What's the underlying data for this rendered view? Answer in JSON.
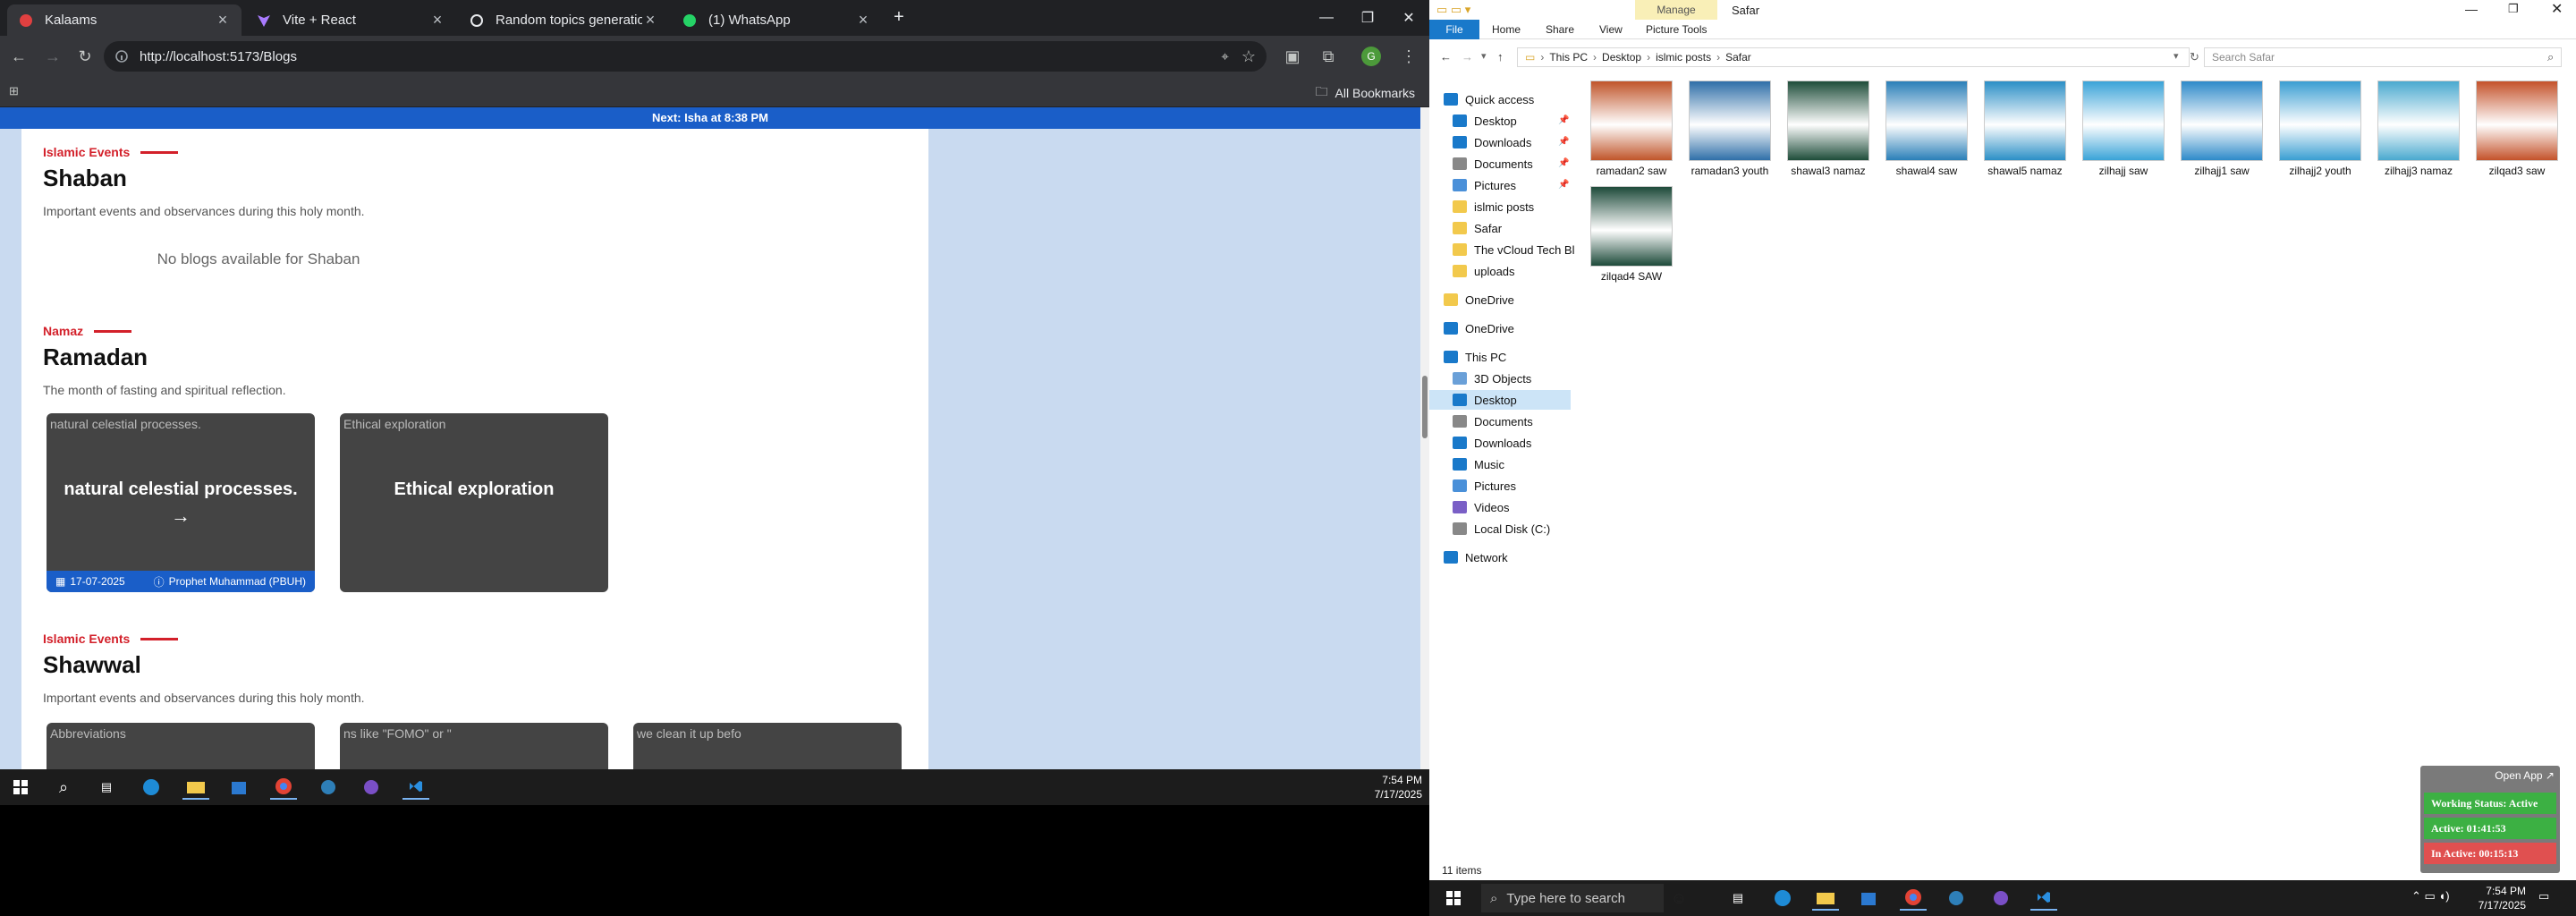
{
  "chrome": {
    "tabs": [
      {
        "label": "Kalaams",
        "active": true,
        "icon": "app-favicon"
      },
      {
        "label": "Vite + React",
        "active": false,
        "icon": "vite-favicon"
      },
      {
        "label": "Random topics generation",
        "active": false,
        "icon": "openai-favicon"
      },
      {
        "label": "(1) WhatsApp",
        "active": false,
        "icon": "whatsapp-favicon"
      }
    ],
    "url": "http://localhost:5173/Blogs",
    "all_bookmarks": "All Bookmarks"
  },
  "page": {
    "next_bar": "Next: Isha at 8:38 PM",
    "sections": [
      {
        "tag": "Islamic Events",
        "title": "Shaban",
        "desc": "Important events and observances during this holy month.",
        "empty": "No blogs available for Shaban"
      },
      {
        "tag": "Namaz",
        "title": "Ramadan",
        "desc": "The month of fasting and spiritual reflection.",
        "cards": [
          {
            "alt": "natural celestial processes.",
            "title": "natural celestial processes.",
            "arrow": "→",
            "date": "17-07-2025",
            "author": "Prophet Muhammad (PBUH)"
          },
          {
            "alt": "Ethical exploration",
            "title": "Ethical exploration"
          }
        ]
      },
      {
        "tag": "Islamic Events",
        "title": "Shawwal",
        "desc": "Important events and observances during this holy month.",
        "cards": [
          {
            "alt": "Abbreviations"
          },
          {
            "alt": "ns like \"FOMO\" or \""
          },
          {
            "alt": "we clean it up befo"
          }
        ]
      }
    ]
  },
  "left_taskbar": {
    "time": "7:54 PM",
    "date": "7/17/2025"
  },
  "explorer": {
    "title": "Safar",
    "manage_label": "Manage",
    "ribbon_tabs": [
      "File",
      "Home",
      "Share",
      "View",
      "Picture Tools"
    ],
    "breadcrumb": [
      "This PC",
      "Desktop",
      "islmic posts",
      "Safar"
    ],
    "search_placeholder": "Search Safar",
    "nav": [
      {
        "label": "Quick access",
        "icon": "star-icon"
      },
      {
        "label": "Desktop",
        "icon": "desktop-icon",
        "pinned": true
      },
      {
        "label": "Downloads",
        "icon": "download-icon",
        "pinned": true
      },
      {
        "label": "Documents",
        "icon": "documents-icon",
        "pinned": true
      },
      {
        "label": "Pictures",
        "icon": "pictures-icon",
        "pinned": true
      },
      {
        "label": "islmic posts",
        "icon": "folder-icon"
      },
      {
        "label": "Safar",
        "icon": "folder-icon"
      },
      {
        "label": "The vCloud Tech Bl",
        "icon": "folder-icon"
      },
      {
        "label": "uploads",
        "icon": "folder-icon"
      },
      {
        "label": "OneDrive",
        "icon": "folder-icon"
      },
      {
        "label": "OneDrive",
        "icon": "cloud-icon"
      },
      {
        "label": "This PC",
        "icon": "pc-icon"
      },
      {
        "label": "3D Objects",
        "icon": "cube-icon"
      },
      {
        "label": "Desktop",
        "icon": "desktop-icon",
        "selected": true
      },
      {
        "label": "Documents",
        "icon": "documents-icon"
      },
      {
        "label": "Downloads",
        "icon": "download-icon"
      },
      {
        "label": "Music",
        "icon": "music-icon"
      },
      {
        "label": "Pictures",
        "icon": "pictures-icon"
      },
      {
        "label": "Videos",
        "icon": "videos-icon"
      },
      {
        "label": "Local Disk (C:)",
        "icon": "disk-icon"
      },
      {
        "label": "Network",
        "icon": "network-icon"
      }
    ],
    "files": [
      {
        "name": "ramadan2 saw",
        "color": "#c0552a"
      },
      {
        "name": "ramadan3 youth",
        "color": "#2f6fa8"
      },
      {
        "name": "shawal3 namaz",
        "color": "#1e4d3a"
      },
      {
        "name": "shawal4 saw",
        "color": "#2a7fb8"
      },
      {
        "name": "shawal5 namaz",
        "color": "#2b8fc6"
      },
      {
        "name": "zilhajj saw",
        "color": "#3aa3d8"
      },
      {
        "name": "zilhajj1 saw",
        "color": "#2e8ac9"
      },
      {
        "name": "zilhajj2 youth",
        "color": "#3a9ed2"
      },
      {
        "name": "zilhajj3 namaz",
        "color": "#4aa9cf"
      },
      {
        "name": "zilqad3 saw",
        "color": "#c4522a"
      },
      {
        "name": "zilqad4 SAW",
        "color": "#1d4a3a"
      }
    ],
    "status": "11 items"
  },
  "right_taskbar": {
    "search_placeholder": "Type here to search",
    "time": "7:54 PM",
    "date": "7/17/2025"
  },
  "widget": {
    "open_app": "Open App ↗",
    "working": "Working Status: Active",
    "active": "Active: 01:41:53",
    "inactive": "In Active: 00:15:13",
    "colors": {
      "working": "#3cb043",
      "active": "#3cb043",
      "inactive": "#e05050"
    }
  }
}
